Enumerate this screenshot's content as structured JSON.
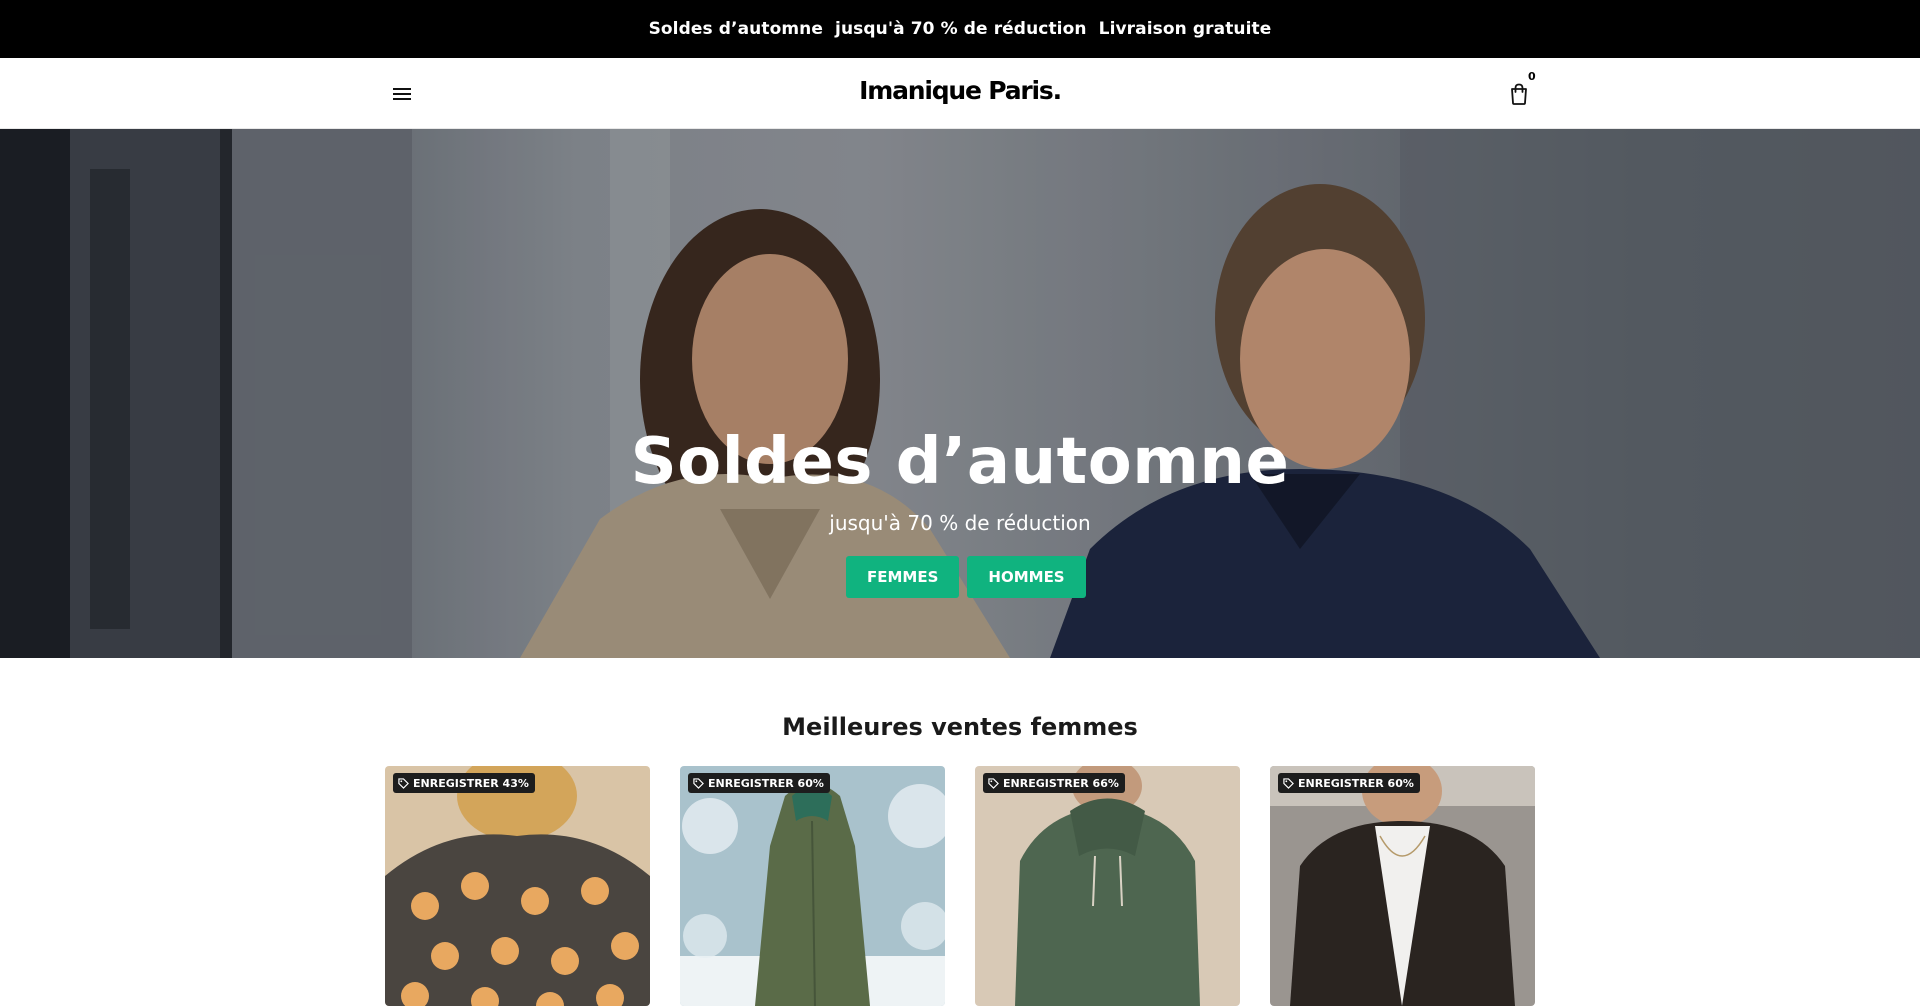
{
  "announcement": {
    "text": "Soldes d’automne  jusqu'à 70 % de réduction  Livraison gratuite"
  },
  "header": {
    "brand": "Imanique Paris.",
    "cart_count": "0"
  },
  "hero": {
    "title": "Soldes d’automne",
    "subtitle": "jusqu'à 70 % de réduction",
    "buttons": [
      {
        "label": "FEMMES"
      },
      {
        "label": "HOMMES"
      }
    ]
  },
  "bestsellers": {
    "title": "Meilleures ventes femmes",
    "products": [
      {
        "badge": "ENREGISTRER 43%",
        "image": "floral fleece pullover"
      },
      {
        "badge": "ENREGISTRER 60%",
        "image": "green hooded coat in snow"
      },
      {
        "badge": "ENREGISTRER 66%",
        "image": "green knit hoodie"
      },
      {
        "badge": "ENREGISTRER 60%",
        "image": "black leather jacket"
      }
    ]
  },
  "colors": {
    "announcement_bg": "#000000",
    "accent_button": "#10b37f",
    "badge_bg": "#1d1d1d"
  },
  "icons": {
    "menu": "hamburger-menu-icon",
    "cart": "shopping-bag-icon",
    "badge": "price-tag-icon"
  }
}
